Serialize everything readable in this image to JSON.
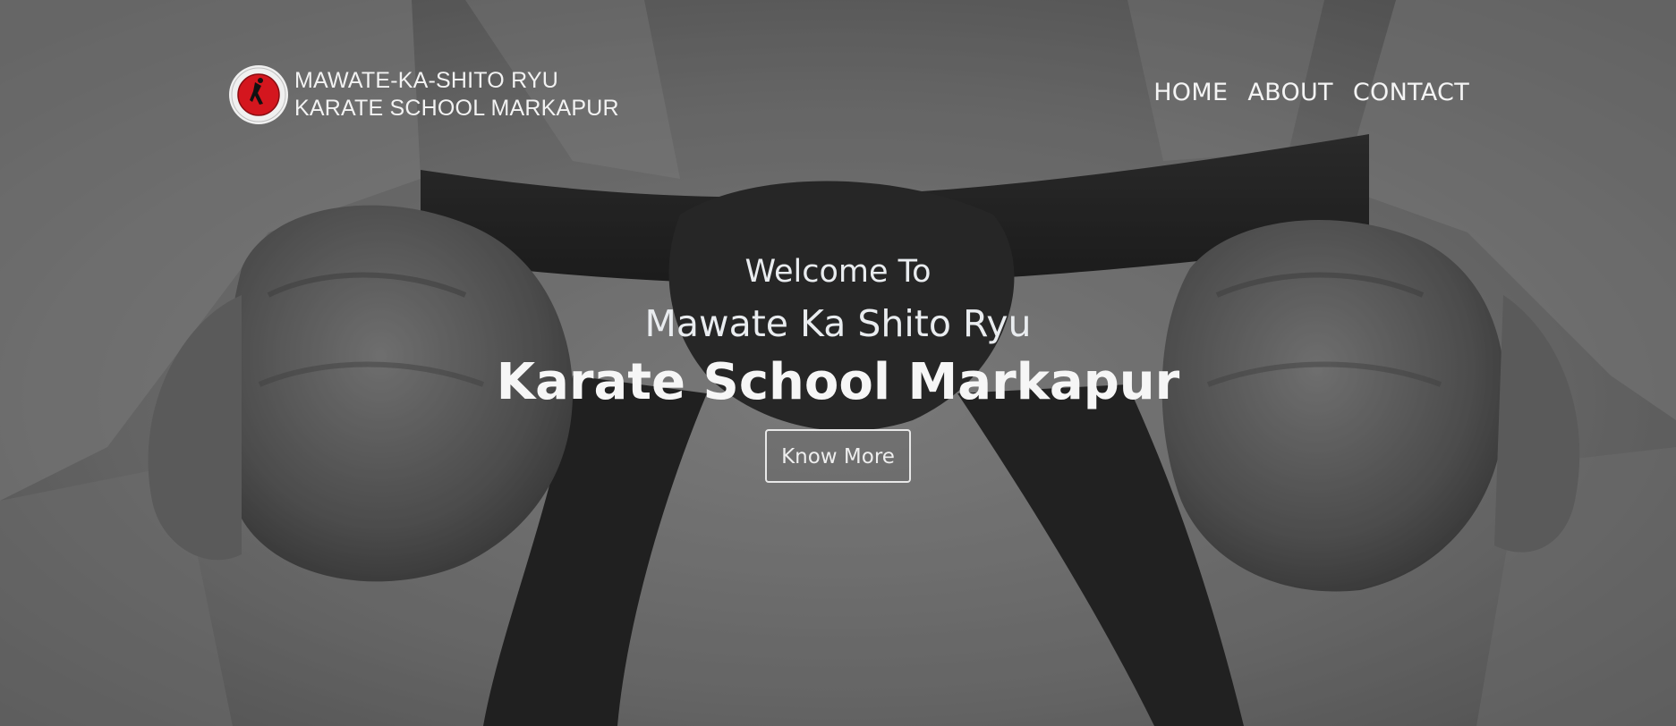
{
  "brand": {
    "line1": "MAWATE-KA-SHITO RYU",
    "line2": "KARATE SCHOOL MARKAPUR"
  },
  "nav": {
    "items": [
      {
        "label": "HOME"
      },
      {
        "label": "ABOUT"
      },
      {
        "label": "CONTACT"
      }
    ]
  },
  "hero": {
    "welcome": "Welcome To",
    "subtitle": "Mawate Ka Shito Ryu",
    "title": "Karate School Markapur",
    "button_label": "Know More"
  },
  "colors": {
    "logo_red": "#d4161e",
    "text_light": "#f2f2f2",
    "belt_black": "#1c1c1c",
    "gi_gray": "#8e8e8e"
  }
}
